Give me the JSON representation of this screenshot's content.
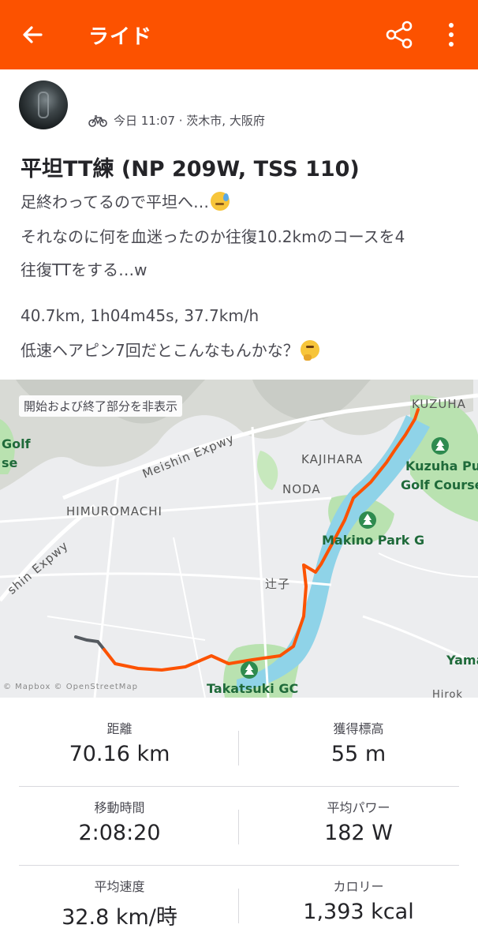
{
  "header": {
    "title": "ライド",
    "back_icon": "back-arrow-icon",
    "share_icon": "share-icon",
    "more_icon": "more-vertical-icon",
    "color": "#fc5200"
  },
  "activity": {
    "meta": "今日 11:07 · 茨木市, 大阪府",
    "title": "平坦TT練 (NP 209W, TSS 110)",
    "desc_lines": [
      "足終わってるので平坦へ…",
      "それなのに何を血迷ったのか往復10.2kmのコースを4",
      "往復TTをする…w"
    ],
    "summary": "40.7km, 1h04m45s, 37.7km/h",
    "note": "低速ヘアピン7回だとこんなもんかな？"
  },
  "map": {
    "hide_label": "開始および終了部分を非表示",
    "labels": {
      "kuzuha": "KUZUHA",
      "golf": "Golf",
      "se": "se",
      "meishin": "Meishin Expwy",
      "kajihara": "KAJIHARA",
      "kuzuha_golf_1": "Kuzuha Publi",
      "kuzuha_golf_2": "Golf Course",
      "noda": "NODA",
      "himuromachi": "HIMUROMACHI",
      "makino": "Makino Park G",
      "expwy": "shin Expwy",
      "tsujiko": "辻子",
      "yama": "Yama",
      "takatsuki": "Takatsuki GC",
      "hiroko": "Hirok",
      "copyright": "© Mapbox © OpenStreetMap"
    },
    "route_color": "#fc5200",
    "water_color": "#8fd3e8",
    "park_color": "#b9e2b0"
  },
  "stats": [
    {
      "label": "距離",
      "value": "70.16 km"
    },
    {
      "label": "獲得標高",
      "value": "55 m"
    },
    {
      "label": "移動時間",
      "value": "2:08:20"
    },
    {
      "label": "平均パワー",
      "value": "182 W"
    },
    {
      "label": "平均速度",
      "value": "32.8 km/時"
    },
    {
      "label": "カロリー",
      "value": "1,393 kcal"
    }
  ]
}
